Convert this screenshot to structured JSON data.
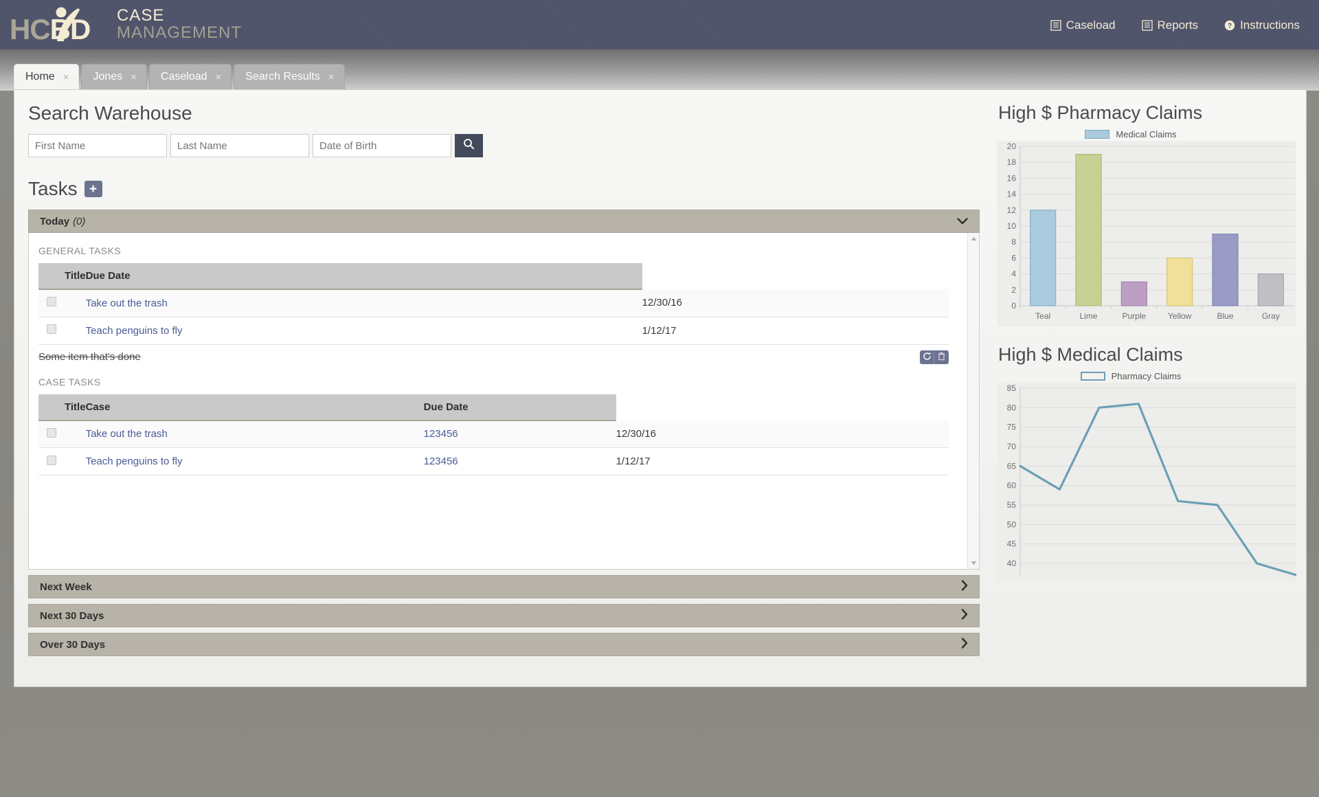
{
  "header": {
    "logo": {
      "hc": "HC",
      "bd": "BD",
      "mark_name": "hcbd-logo"
    },
    "brand_line1": "CASE",
    "brand_line2": "MANAGEMENT",
    "nav": [
      {
        "label": "Caseload",
        "icon": "list-icon"
      },
      {
        "label": "Reports",
        "icon": "list-icon"
      },
      {
        "label": "Instructions",
        "icon": "question-circle-icon"
      }
    ]
  },
  "tabs": [
    {
      "label": "Home",
      "active": true,
      "close": "×"
    },
    {
      "label": "Jones",
      "active": false,
      "close": "×"
    },
    {
      "label": "Caseload",
      "active": false,
      "close": "×"
    },
    {
      "label": "Search Results",
      "active": false,
      "close": "×"
    }
  ],
  "search": {
    "title": "Search Warehouse",
    "first_name_placeholder": "First Name",
    "first_name_value": "",
    "last_name_placeholder": "Last Name",
    "last_name_value": "",
    "dob_placeholder": "Date of Birth",
    "dob_value": "",
    "submit_icon": "search-icon"
  },
  "tasks": {
    "title": "Tasks",
    "add_label": "+",
    "accordions": [
      {
        "label": "Today",
        "count": "(0)",
        "expanded": true,
        "chevron": "⌄"
      },
      {
        "label": "Next Week",
        "count": "",
        "expanded": false,
        "chevron": "❯"
      },
      {
        "label": "Next 30 Days",
        "count": "",
        "expanded": false,
        "chevron": "❯"
      },
      {
        "label": "Over 30 Days",
        "count": "",
        "expanded": false,
        "chevron": "❯"
      }
    ],
    "general": {
      "label": "GENERAL TASKS",
      "columns": [
        "Title",
        "Due Date"
      ],
      "rows": [
        {
          "title": "Take out the trash",
          "due": "12/30/16"
        },
        {
          "title": "Teach penguins to fly",
          "due": "1/12/17"
        }
      ],
      "done_item": "Some item that's done",
      "done_actions": [
        {
          "name": "restore-task-button",
          "icon": "refresh-icon",
          "glyph": "↻"
        },
        {
          "name": "delete-task-button",
          "icon": "trash-icon",
          "glyph": "🗑"
        }
      ]
    },
    "case": {
      "label": "CASE TASKS",
      "columns": [
        "Title",
        "Case",
        "Due Date"
      ],
      "rows": [
        {
          "title": "Take out the trash",
          "case": "123456",
          "due": "12/30/16"
        },
        {
          "title": "Teach penguins to fly",
          "case": "123456",
          "due": "1/12/17"
        }
      ]
    }
  },
  "charts": {
    "bar_title": "High $ Pharmacy Claims",
    "line_title": "High $ Medical Claims"
  },
  "chart_data": [
    {
      "type": "bar",
      "title": "High $ Pharmacy Claims",
      "legend": [
        "Medical Claims"
      ],
      "legend_position": "top-center",
      "categories": [
        "Teal",
        "Lime",
        "Purple",
        "Yellow",
        "Blue",
        "Gray"
      ],
      "values": [
        12,
        19,
        3,
        6,
        9,
        4
      ],
      "bar_colors": [
        "#a9cbdd",
        "#c6d294",
        "#bd9ec4",
        "#f0e09a",
        "#9a9cc6",
        "#bfbfc4"
      ],
      "bar_border_colors": [
        "#7fa8bf",
        "#a6b46d",
        "#9c7aa5",
        "#d3bf6e",
        "#7b7eae",
        "#a0a0a8"
      ],
      "ylim": [
        0,
        20
      ],
      "yticks": [
        0,
        2,
        4,
        6,
        8,
        10,
        12,
        14,
        16,
        18,
        20
      ],
      "xlabel": "",
      "ylabel": "",
      "grid": true
    },
    {
      "type": "line",
      "title": "High $ Medical Claims",
      "legend": [
        "Pharmacy Claims"
      ],
      "legend_position": "top-center",
      "x": [
        0,
        1,
        2,
        3,
        4,
        5,
        6,
        7
      ],
      "values": [
        65,
        59,
        80,
        81,
        56,
        55,
        40,
        37
      ],
      "line_color": "#6b9fb5",
      "ylim": [
        37,
        85
      ],
      "yticks": [
        40,
        45,
        50,
        55,
        60,
        65,
        70,
        75,
        80,
        85
      ],
      "xlabel": "",
      "ylabel": "",
      "grid": true
    }
  ],
  "scrollbar": {
    "up": "▲",
    "down": "▼"
  }
}
